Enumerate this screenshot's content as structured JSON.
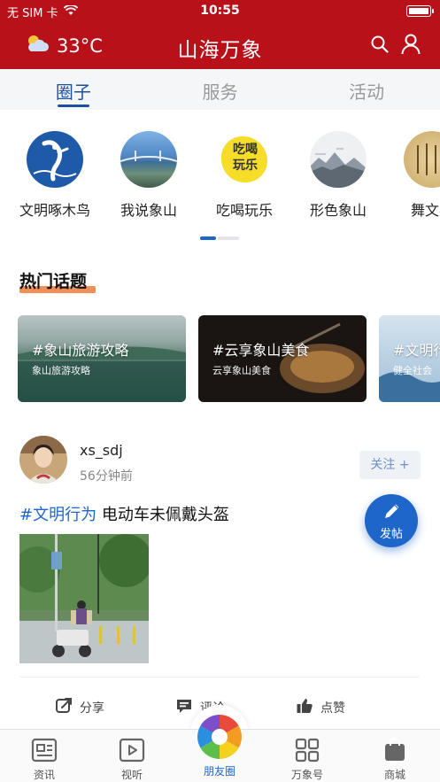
{
  "status_bar": {
    "carrier": "无 SIM 卡",
    "time": "10:55"
  },
  "header": {
    "temperature": "33°C",
    "title": "山海万象",
    "weather_icon": "partly-cloudy-icon"
  },
  "tabs": [
    {
      "label": "圈子",
      "active": true
    },
    {
      "label": "服务",
      "active": false
    },
    {
      "label": "活动",
      "active": false
    }
  ],
  "circles": [
    {
      "label": "文明啄木鸟"
    },
    {
      "label": "我说象山"
    },
    {
      "label": "吃喝玩乐",
      "badge_text": "吃喝玩乐"
    },
    {
      "label": "形色象山"
    },
    {
      "label": "舞文弄"
    }
  ],
  "hot_topics": {
    "title": "热门话题",
    "items": [
      {
        "title": "#象山旅游攻略",
        "subtitle": "象山旅游攻略"
      },
      {
        "title": "#云享象山美食",
        "subtitle": "云享象山美食"
      },
      {
        "title": "#文明行",
        "subtitle": "健全社会"
      }
    ]
  },
  "post": {
    "username": "xs_sdj",
    "time": "56分钟前",
    "follow_label": "关注 +",
    "tag": "#文明行为",
    "text": " 电动车未佩戴头盔",
    "actions": {
      "share": "分享",
      "comment": "评论",
      "like": "点赞"
    }
  },
  "fab": {
    "label": "发帖"
  },
  "bottom_nav": [
    {
      "label": "资讯"
    },
    {
      "label": "视听"
    },
    {
      "label": "朋友圈",
      "active": true
    },
    {
      "label": "万象号"
    },
    {
      "label": "商城"
    }
  ],
  "colors": {
    "brand_red": "#b8111a",
    "accent_blue": "#1e66c9",
    "tab_blue": "#1c4f9e",
    "underline_orange": "#f07a3a"
  }
}
